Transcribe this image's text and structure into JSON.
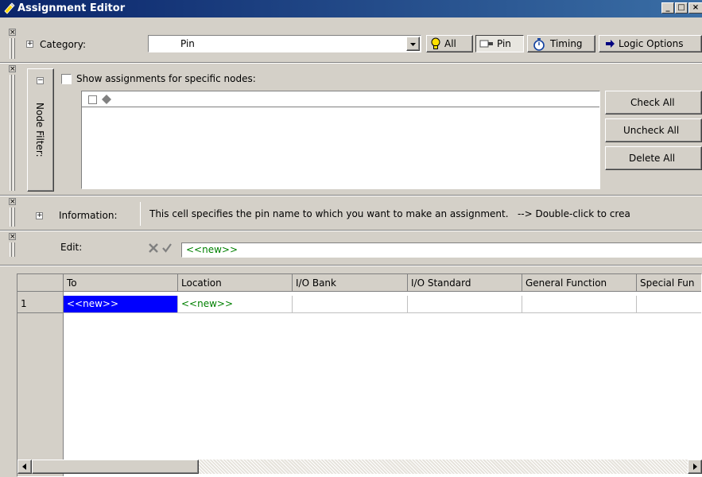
{
  "window": {
    "title": "Assignment Editor"
  },
  "category_bar": {
    "category_label": "Category:",
    "category_value": "Pin",
    "buttons": {
      "all": "All",
      "pin": "Pin",
      "timing": "Timing",
      "logic_options": "Logic Options"
    }
  },
  "node_filter": {
    "vertical_label": "Node Filter:",
    "checkbox_label": "Show assignments for specific nodes:",
    "check_all": "Check All",
    "uncheck_all": "Uncheck All",
    "delete_all": "Delete All"
  },
  "information": {
    "label": "Information:",
    "text": "This cell specifies the pin name to which you want to make an assignment.   --> Double-click to crea"
  },
  "edit": {
    "label": "Edit:",
    "value": "<<new>>"
  },
  "grid": {
    "columns": [
      "To",
      "Location",
      "I/O Bank",
      "I/O Standard",
      "General Function",
      "Special Fun"
    ],
    "rows": [
      {
        "num": "1",
        "to": "<<new>>",
        "location": "<<new>>",
        "io_bank": "",
        "io_standard": "",
        "general_function": "",
        "special_function": ""
      }
    ]
  },
  "colors": {
    "title_gradient_start": "#0a246a",
    "title_gradient_end": "#3a6ea5",
    "selection": "#0000ff",
    "new_text": "#008000"
  }
}
